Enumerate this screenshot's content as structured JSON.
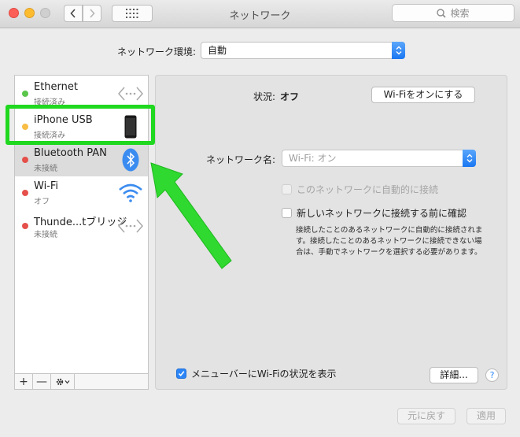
{
  "window": {
    "title": "ネットワーク"
  },
  "toolbar": {
    "search_placeholder": "検索"
  },
  "location": {
    "label": "ネットワーク環境:",
    "value": "自動"
  },
  "services": [
    {
      "name": "Ethernet",
      "status": "接続済み",
      "dot_color": "#5ac64a",
      "icon": "ethernet-icon"
    },
    {
      "name": "iPhone USB",
      "status": "接続済み",
      "dot_color": "#f7bd45",
      "icon": "iphone-icon"
    },
    {
      "name": "Bluetooth PAN",
      "status": "未接続",
      "dot_color": "#e5504a",
      "icon": "bluetooth-icon"
    },
    {
      "name": "Wi-Fi",
      "status": "オフ",
      "dot_color": "#e5504a",
      "icon": "wifi-icon"
    },
    {
      "name": "Thunde...tブリッジ",
      "status": "未接続",
      "dot_color": "#e5504a",
      "icon": "thunderbolt-bridge-icon"
    }
  ],
  "sidebar_toolbar": {
    "add": "+",
    "remove": "—"
  },
  "detail": {
    "status_label": "状況:",
    "status_value": "オフ",
    "wifi_toggle_button": "Wi-Fiをオンにする",
    "network_name_label": "ネットワーク名:",
    "network_name_value": "Wi-Fi: オン",
    "auto_join_label": "このネットワークに自動的に接続",
    "ask_join_label": "新しいネットワークに接続する前に確認",
    "ask_join_note": "接続したことのあるネットワークに自動的に接続されます。接続したことのあるネットワークに接続できない場合は、手動でネットワークを選択する必要があります。",
    "menubar_label": "メニューバーにWi-Fiの状況を表示",
    "advanced_button": "詳細...",
    "help_button": "?"
  },
  "footer": {
    "revert_button": "元に戻す",
    "apply_button": "適用"
  },
  "annotation": {
    "highlight_color": "#1fd81f"
  }
}
